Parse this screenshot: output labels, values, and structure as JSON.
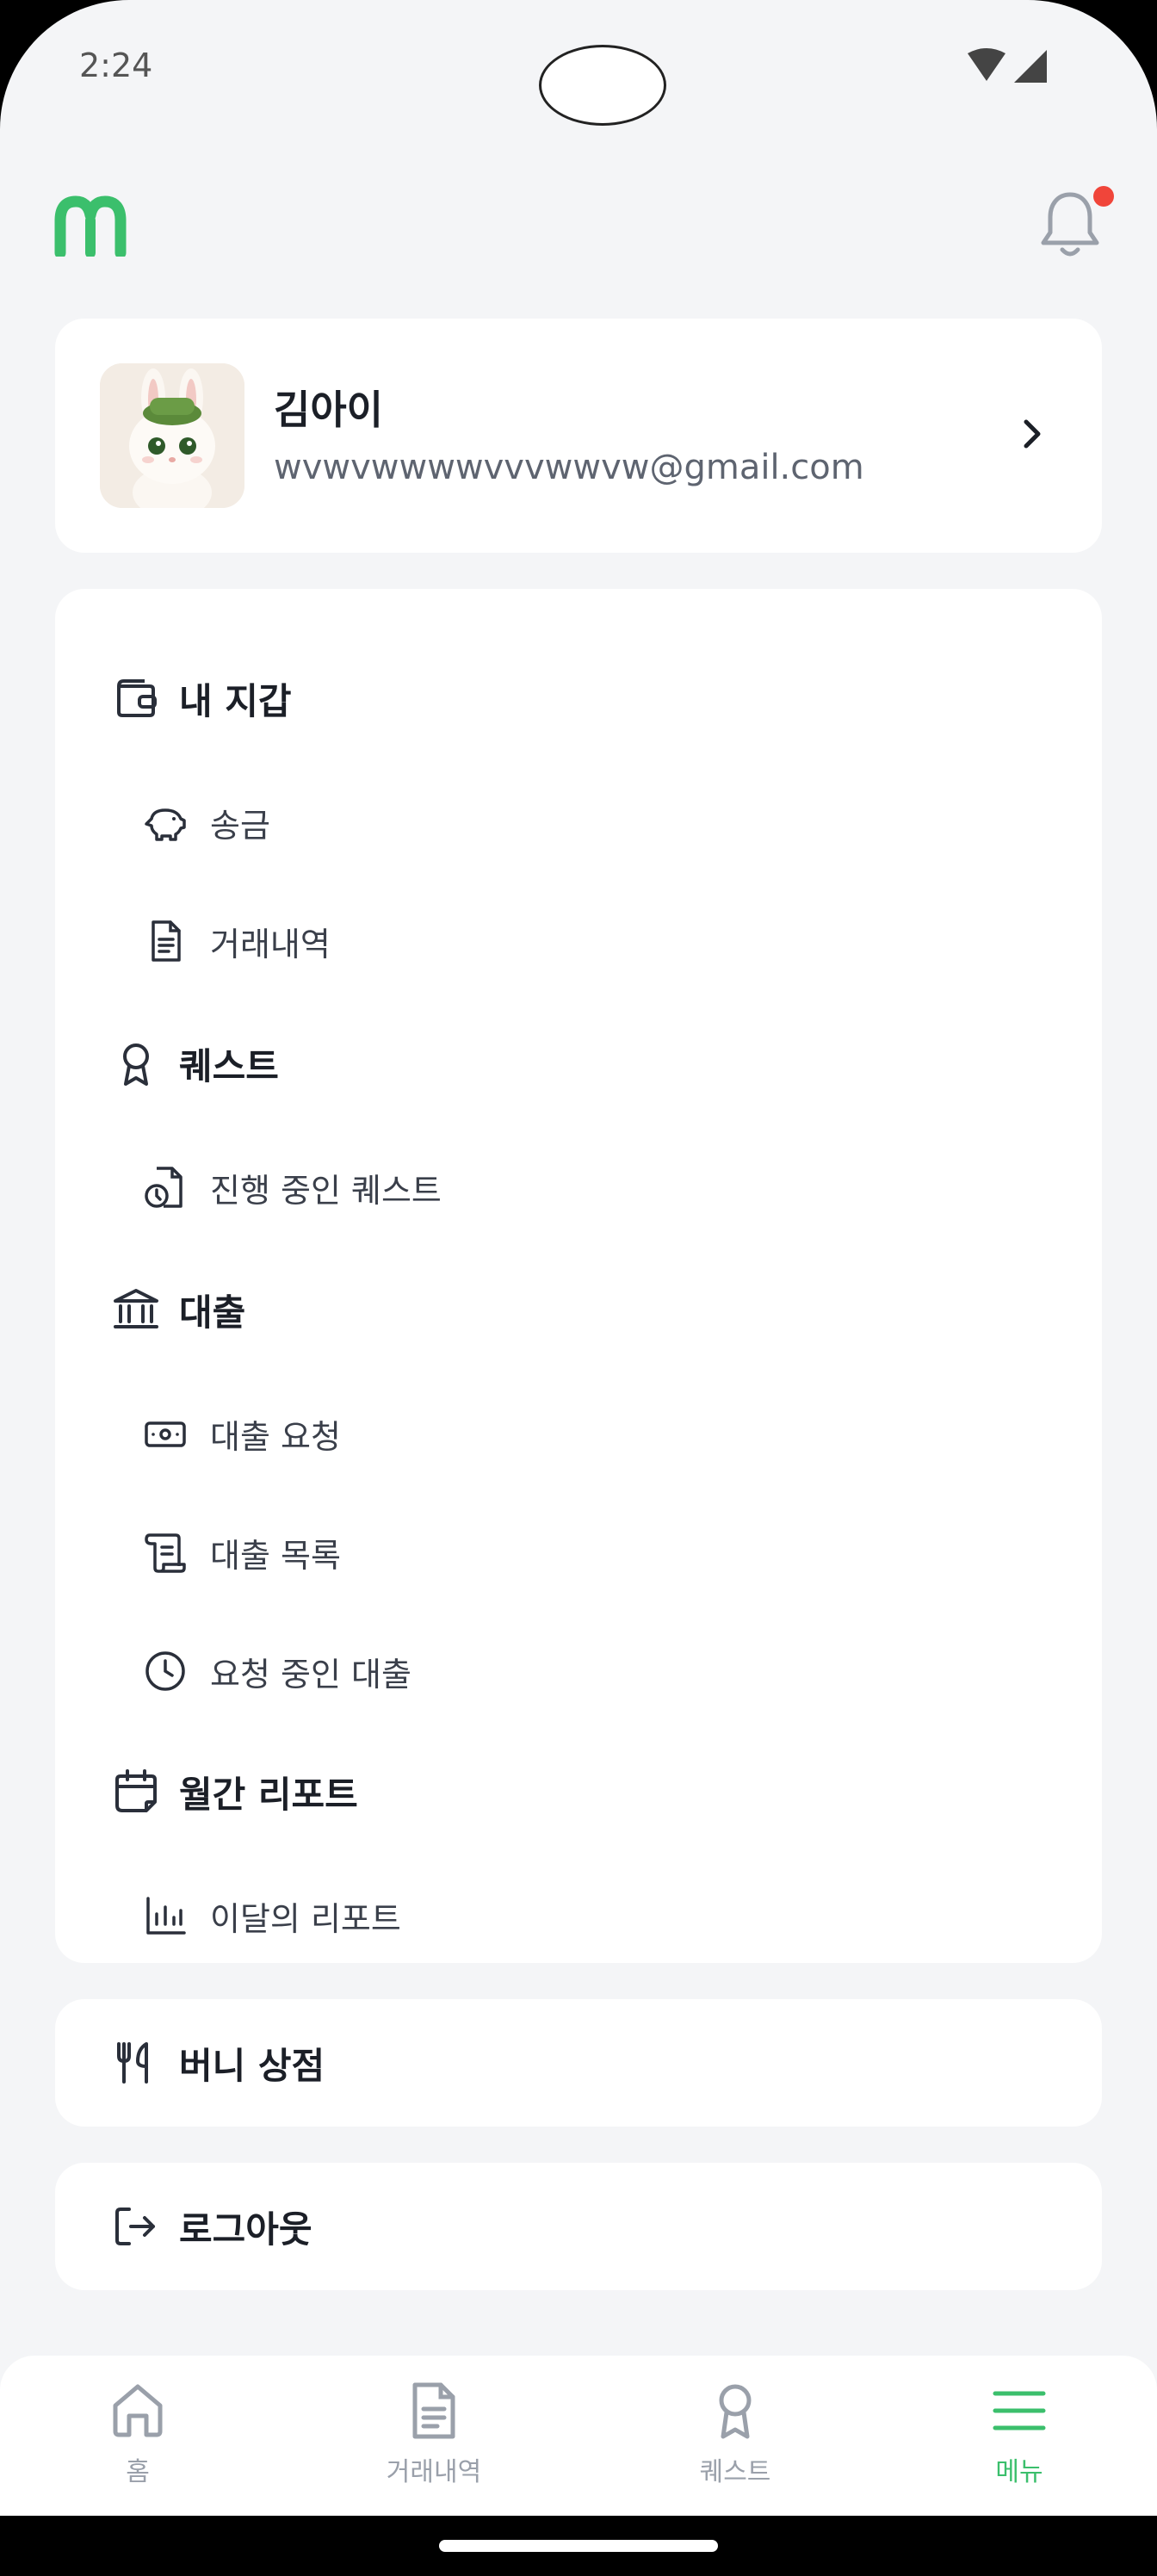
{
  "status_bar": {
    "time": "2:24"
  },
  "header": {
    "logo": "m-logo",
    "notification_icon": "bell-icon",
    "has_unread": true
  },
  "profile": {
    "name": "김아이",
    "email": "wvwvwwwwvvvwwvw@gmail.com"
  },
  "menu": {
    "wallet": {
      "label": "내 지갑",
      "items": {
        "transfer": "송금",
        "history": "거래내역"
      }
    },
    "quest": {
      "label": "퀘스트",
      "items": {
        "ongoing": "진행 중인 퀘스트"
      }
    },
    "loan": {
      "label": "대출",
      "items": {
        "request": "대출 요청",
        "list": "대출 목록",
        "pending": "요청 중인 대출"
      }
    },
    "report": {
      "label": "월간 리포트",
      "items": {
        "this_month": "이달의 리포트"
      }
    }
  },
  "store": {
    "label": "버니 상점"
  },
  "logout": {
    "label": "로그아웃"
  },
  "bottom_nav": {
    "home": "홈",
    "history": "거래내역",
    "quest": "퀘스트",
    "menu": "메뉴",
    "active": "menu"
  },
  "colors": {
    "accent": "#3bbf6c",
    "notification_dot": "#f0453a",
    "background": "#f4f5f7"
  }
}
